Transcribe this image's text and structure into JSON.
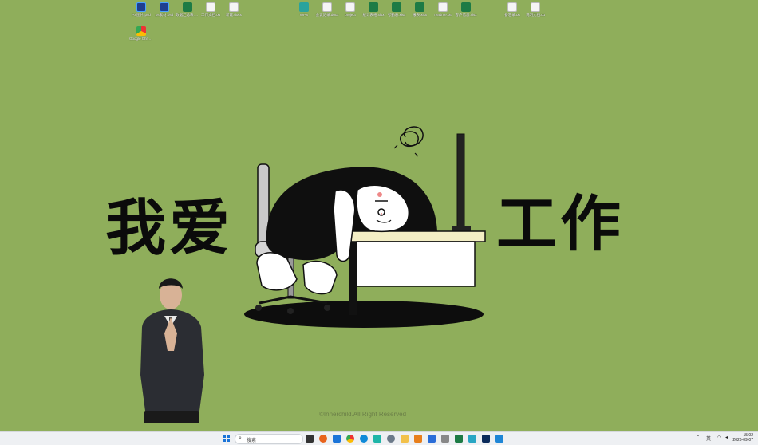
{
  "desktop": {
    "icons": [
      {
        "label": "PS图片.psd",
        "kind": "ps"
      },
      {
        "label": "ps素材.psd",
        "kind": "ps"
      },
      {
        "label": "数据汇总表.xlsx",
        "kind": "xls"
      },
      {
        "label": "工作文档.txt",
        "kind": "doc"
      },
      {
        "label": "新建.docx",
        "kind": "doc"
      },
      {
        "label": "Google Chrome",
        "kind": "chrome"
      },
      {
        "label": "WPS",
        "kind": "app"
      },
      {
        "label": "会议记录.docx",
        "kind": "doc"
      },
      {
        "label": "project",
        "kind": "doc"
      },
      {
        "label": "统计表格.xlsx",
        "kind": "xls"
      },
      {
        "label": "考勤表.xlsx",
        "kind": "xls"
      },
      {
        "label": "报表.xlsx",
        "kind": "xls"
      },
      {
        "label": "readme.txt",
        "kind": "doc"
      },
      {
        "label": "客户信息.xlsx",
        "kind": "xls"
      },
      {
        "label": "备忘录.txt",
        "kind": "doc"
      },
      {
        "label": "说明文档.txt",
        "kind": "doc"
      }
    ]
  },
  "wallpaper": {
    "left_text": "我爱",
    "right_text": "工作",
    "copyright": "©Innerchild.All Right Reserved",
    "background_color": "#8fae5b"
  },
  "taskbar": {
    "search_placeholder": "搜索",
    "search_icon": "search-icon",
    "start_icon": "windows-start-icon",
    "ime_label": "英",
    "time": "15:02",
    "date": "2026-09-07"
  }
}
